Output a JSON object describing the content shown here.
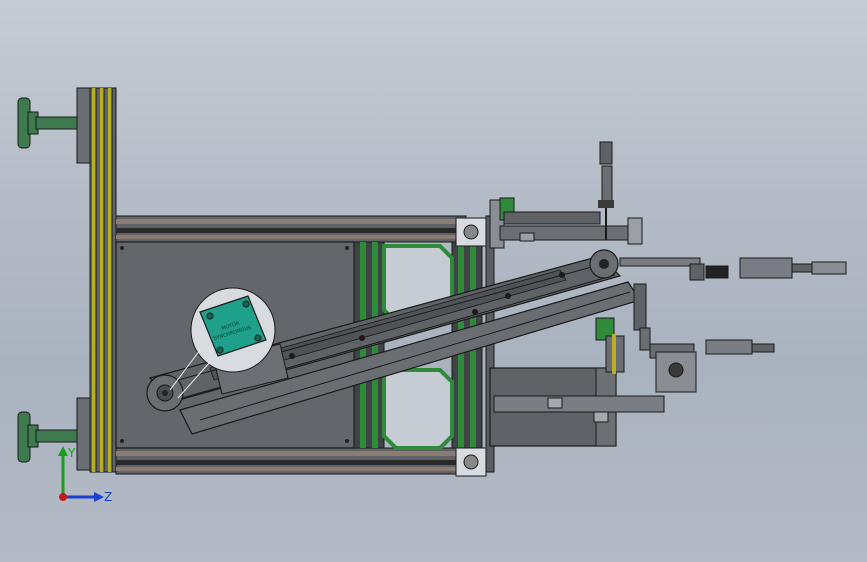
{
  "viewport": {
    "background_top": "#c7ccd4",
    "background_bottom": "#b3bbc6"
  },
  "motor_label": {
    "line1": "MOTOR",
    "line2": "SYNCHRONOUS"
  },
  "triad": {
    "y_label": "Y",
    "z_label": "Z"
  },
  "colors": {
    "frame_gray": "#5f6266",
    "rail_brown": "#8a7c70",
    "rail_yellow": "#b8b020",
    "accent_green": "#2f8a3a",
    "motor_teal": "#1fa08a",
    "stem_green": "#3e7a4e",
    "outline": "#1a1a1a"
  }
}
